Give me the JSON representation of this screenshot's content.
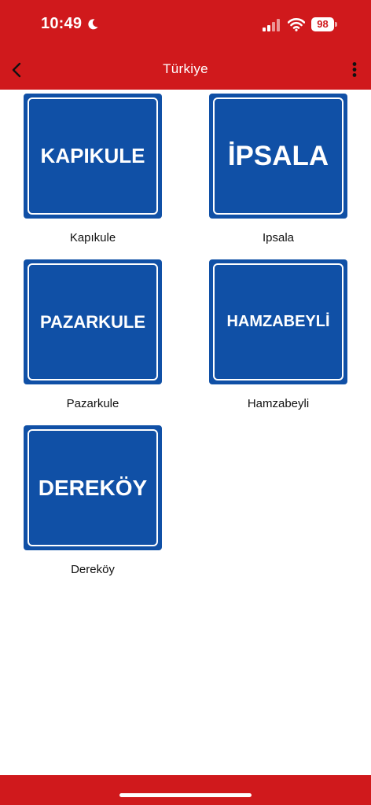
{
  "status_bar": {
    "time": "10:49",
    "battery": "98"
  },
  "header": {
    "title": "Türkiye",
    "back_icon": "chevron-left-icon",
    "menu_icon": "more-vertical-icon"
  },
  "colors": {
    "header": "#d0191c",
    "sign_blue": "#1050a6"
  },
  "items": [
    {
      "sign_text": "KAPIKULE",
      "label": "Kapıkule"
    },
    {
      "sign_text": "İPSALA",
      "label": "Ipsala"
    },
    {
      "sign_text": "PAZARKULE",
      "label": "Pazarkule"
    },
    {
      "sign_text": "HAMZABEYLİ",
      "label": "Hamzabeyli"
    },
    {
      "sign_text": "DEREKÖY",
      "label": "Dereköy"
    }
  ]
}
